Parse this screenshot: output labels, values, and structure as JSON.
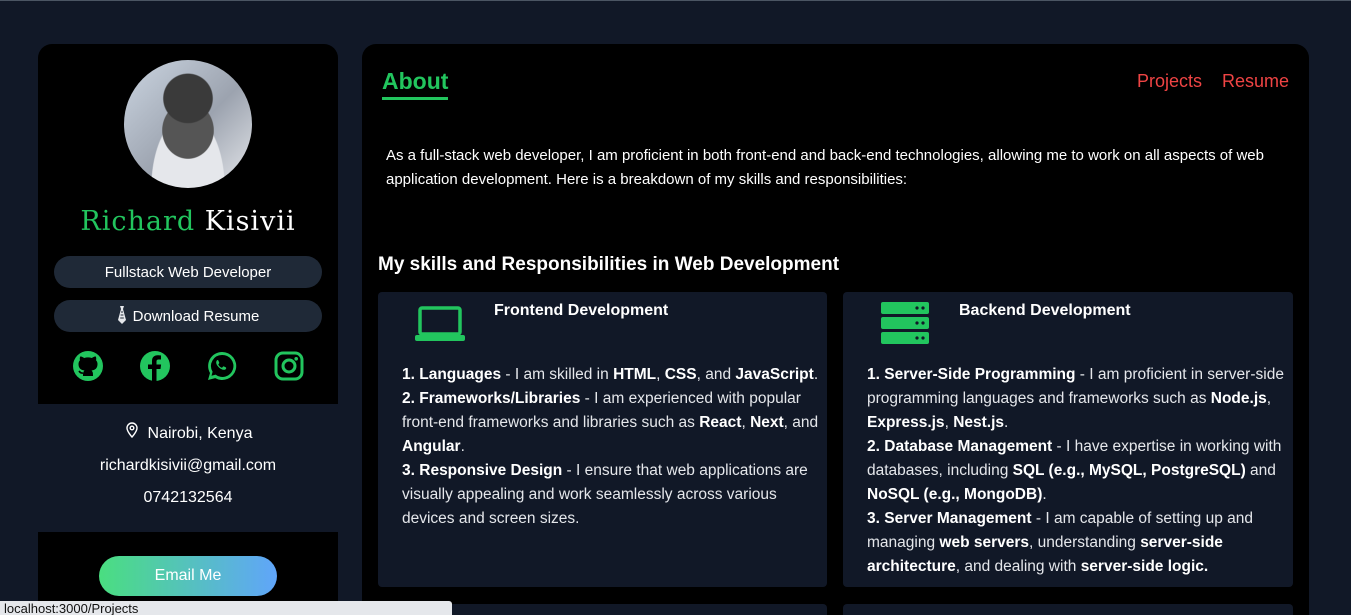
{
  "profile": {
    "first_name": "Richard",
    "last_name": "Kisivii",
    "role": "Fullstack Web Developer",
    "download_label": "Download Resume",
    "location": "Nairobi, Kenya",
    "email": "richardkisivii@gmail.com",
    "phone": "0742132564",
    "email_button": "Email Me",
    "socials": [
      "github-icon",
      "facebook-icon",
      "whatsapp-icon",
      "instagram-icon"
    ]
  },
  "nav": {
    "active": "About",
    "links": [
      "Projects",
      "Resume"
    ]
  },
  "about": {
    "intro": "As a full-stack web developer, I am proficient in both front-end and back-end technologies, allowing me to work on all aspects of web application development. Here is a breakdown of my skills and responsibilities:",
    "skills_heading": "My skills and Responsibilities in Web Development"
  },
  "cards": {
    "frontend": {
      "title": "Frontend Development",
      "icon": "laptop-icon",
      "items": [
        {
          "num": "1.",
          "head": "Languages",
          "parts": [
            " - I am skilled in ",
            "HTML",
            ", ",
            "CSS",
            ", and ",
            "JavaScript",
            "."
          ]
        },
        {
          "num": "2.",
          "head": "Frameworks/Libraries",
          "parts": [
            " - I am experienced with popular front-end frameworks and libraries such as ",
            "React",
            ", ",
            "Next",
            ", and ",
            "Angular",
            "."
          ]
        },
        {
          "num": "3.",
          "head": "Responsive Design",
          "parts": [
            " - I ensure that web applications are visually appealing and work seamlessly across various devices and screen sizes."
          ]
        }
      ]
    },
    "backend": {
      "title": "Backend Development",
      "icon": "server-icon",
      "items": [
        {
          "num": "1.",
          "head": "Server-Side Programming",
          "parts": [
            " - I am proficient in server-side programming languages and frameworks such as ",
            "Node.js",
            ", ",
            "Express.js",
            ", ",
            "Nest.js",
            "."
          ]
        },
        {
          "num": "2.",
          "head": "Database Management",
          "parts": [
            " - I have expertise in working with databases, including ",
            "SQL (e.g., MySQL, PostgreSQL)",
            " and ",
            "NoSQL (e.g., MongoDB)",
            "."
          ]
        },
        {
          "num": "3.",
          "head": "Server Management",
          "parts": [
            " - I am capable of setting up and managing ",
            "web servers",
            ", understanding ",
            "server-side architecture",
            ", and dealing with ",
            "server-side logic."
          ]
        }
      ]
    }
  },
  "status_url": "localhost:3000/Projects",
  "colors": {
    "accent_green": "#22c55e",
    "link_red": "#ef4444",
    "background": "#111827",
    "panel": "#000000",
    "card": "#111827"
  }
}
